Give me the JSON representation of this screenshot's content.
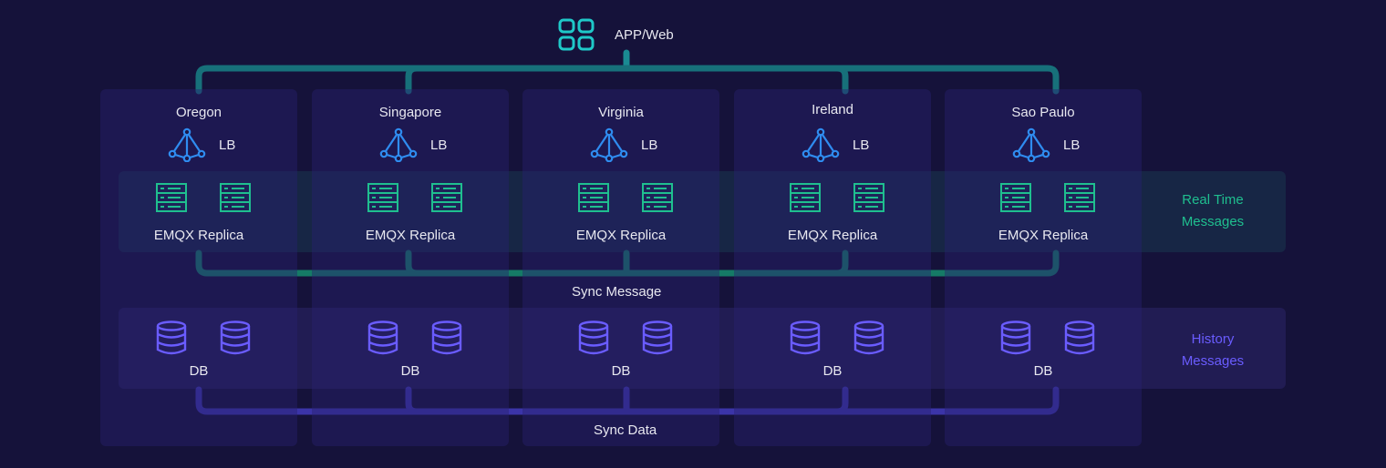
{
  "app": {
    "label": "APP/Web",
    "icon": "app-grid-icon"
  },
  "colors": {
    "background": "#15123a",
    "teal": "#1fc8c8",
    "green": "#1fbf8f",
    "blue": "#2f8cf0",
    "purple": "#6a5cff"
  },
  "regions": [
    {
      "name": "Oregon",
      "lb": "LB",
      "replica": "EMQX Replica",
      "db": "DB"
    },
    {
      "name": "Singapore",
      "lb": "LB",
      "replica": "EMQX Replica",
      "db": "DB"
    },
    {
      "name": "Virginia",
      "lb": "LB",
      "replica": "EMQX Replica",
      "db": "DB"
    },
    {
      "name": "Ireland",
      "lb": "LB",
      "replica": "EMQX Replica",
      "db": "DB"
    },
    {
      "name": "Sao Paulo",
      "lb": "LB",
      "replica": "EMQX Replica",
      "db": "DB"
    }
  ],
  "bands": {
    "realtime": "Real Time Messages",
    "realtime_l1": "Real Time",
    "realtime_l2": "Messages",
    "history_l1": "History",
    "history_l2": "Messages"
  },
  "connectors": {
    "sync_message": "Sync Message",
    "sync_data": "Sync Data"
  }
}
